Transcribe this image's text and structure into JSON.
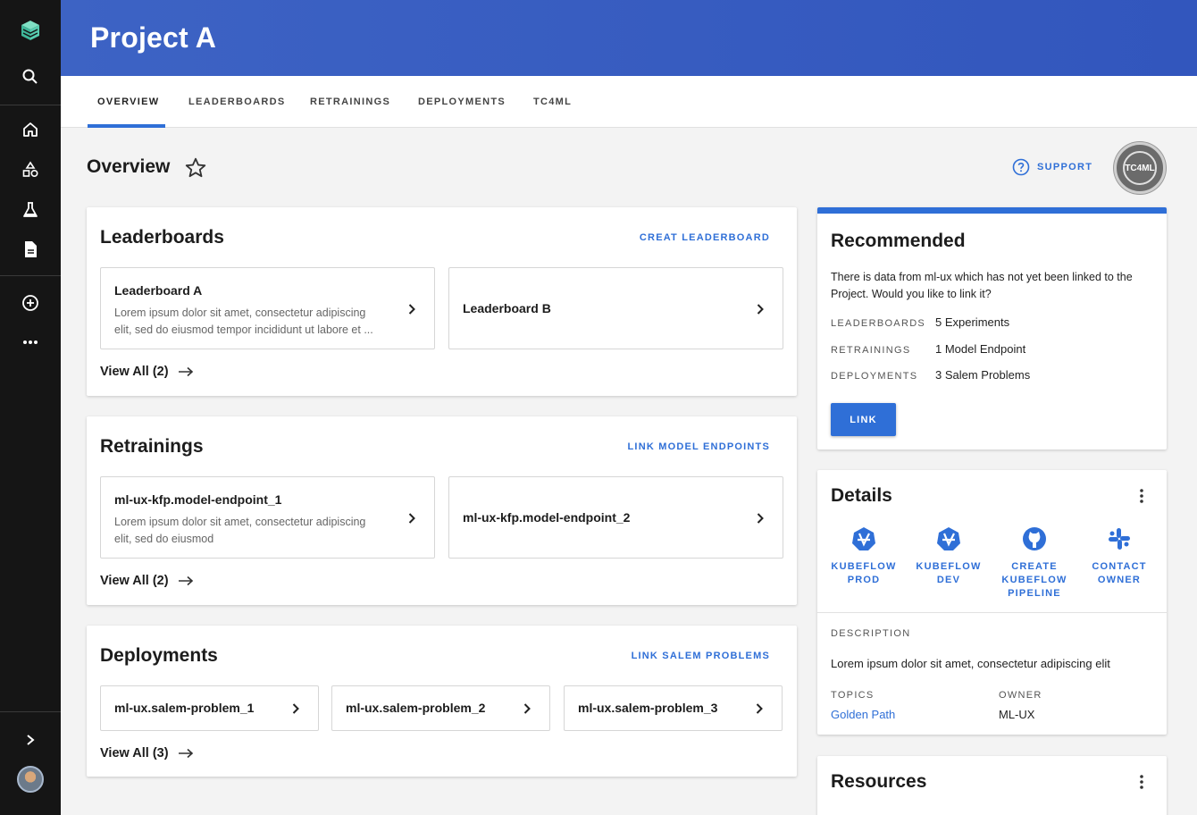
{
  "sidebar": {
    "logo": "cube-stack-logo",
    "items": [
      "search-icon",
      "home-icon",
      "shapes-icon",
      "flask-icon",
      "document-icon",
      "add-circle-icon",
      "more-horizontal-icon"
    ],
    "expand": "chevron-right-icon"
  },
  "header": {
    "title": "Project A"
  },
  "tabs": [
    {
      "label": "OVERVIEW",
      "active": true
    },
    {
      "label": "LEADERBOARDS"
    },
    {
      "label": "RETRAININGS"
    },
    {
      "label": "DEPLOYMENTS"
    },
    {
      "label": "TC4ML"
    }
  ],
  "overview": {
    "title": "Overview",
    "support_label": "SUPPORT",
    "badge_label": "TC4ML"
  },
  "leaderboards": {
    "title": "Leaderboards",
    "action": "CREAT LEADERBOARD",
    "items": [
      {
        "title": "Leaderboard A",
        "desc1": "Lorem ipsum dolor sit amet, consectetur adipiscing",
        "desc2": "elit, sed do eiusmod tempor incididunt ut labore et ..."
      },
      {
        "title": "Leaderboard B"
      }
    ],
    "view_all": "View All (2)"
  },
  "retrainings": {
    "title": "Retrainings",
    "action": "LINK MODEL ENDPOINTS",
    "items": [
      {
        "title": "ml-ux-kfp.model-endpoint_1",
        "desc1": "Lorem ipsum dolor sit amet, consectetur adipiscing",
        "desc2": "elit, sed do eiusmod"
      },
      {
        "title": "ml-ux-kfp.model-endpoint_2"
      }
    ],
    "view_all": "View All (2)"
  },
  "deployments": {
    "title": "Deployments",
    "action": "LINK SALEM PROBLEMS",
    "items": [
      {
        "title": "ml-ux.salem-problem_1"
      },
      {
        "title": "ml-ux.salem-problem_2"
      },
      {
        "title": "ml-ux.salem-problem_3"
      }
    ],
    "view_all": "View All (3)"
  },
  "recommended": {
    "title": "Recommended",
    "text": "There is data from ml-ux which has not yet been linked to the Project. Would you like to link it?",
    "rows": [
      {
        "key": "LEADERBOARDS",
        "value": "5 Experiments"
      },
      {
        "key": "RETRAININGS",
        "value": "1 Model Endpoint"
      },
      {
        "key": "DEPLOYMENTS",
        "value": "3 Salem Problems"
      }
    ],
    "button": "LINK"
  },
  "details": {
    "title": "Details",
    "tools": [
      {
        "icon": "kubeflow-icon",
        "line1": "KUBEFLOW",
        "line2": "PROD",
        "line3": ""
      },
      {
        "icon": "kubeflow-icon",
        "line1": "KUBEFLOW",
        "line2": "DEV",
        "line3": ""
      },
      {
        "icon": "github-icon",
        "line1": "CREATE",
        "line2": "KUBEFLOW",
        "line3": "PIPELINE"
      },
      {
        "icon": "slack-icon",
        "line1": "CONTACT",
        "line2": "OWNER",
        "line3": ""
      }
    ],
    "description_label": "DESCRIPTION",
    "description": "Lorem ipsum dolor sit amet, consectetur adipiscing elit",
    "topics_label": "TOPICS",
    "topics_value": "Golden Path",
    "owner_label": "OWNER",
    "owner_value": "ML-UX"
  },
  "resources": {
    "title": "Resources"
  },
  "colors": {
    "header": "#3d63c4",
    "accent": "#2f6fd7",
    "sidebar": "#151515",
    "logo": "#7fe0c4"
  }
}
